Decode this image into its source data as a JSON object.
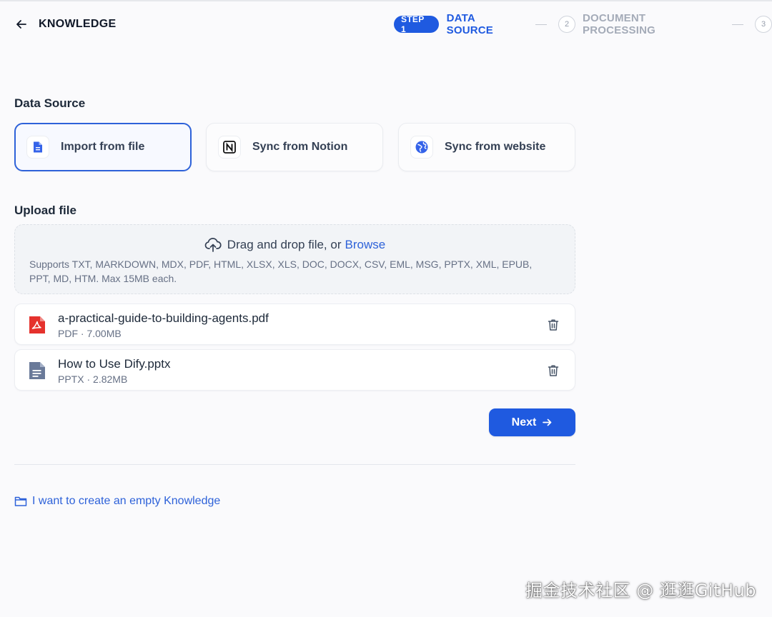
{
  "header": {
    "title": "KNOWLEDGE",
    "back_icon": "arrow-left-icon"
  },
  "steps": {
    "active_badge": "STEP 1",
    "active_label": "DATA SOURCE",
    "step2_number": "2",
    "step2_label": "DOCUMENT PROCESSING",
    "step3_number": "3"
  },
  "data_source": {
    "title": "Data Source",
    "options": [
      {
        "label": "Import from file",
        "icon": "file-icon",
        "selected": true
      },
      {
        "label": "Sync from Notion",
        "icon": "notion-icon",
        "selected": false
      },
      {
        "label": "Sync from website",
        "icon": "globe-icon",
        "selected": false
      }
    ]
  },
  "upload": {
    "title": "Upload file",
    "drop_text": "Drag and drop file, or",
    "browse_label": "Browse",
    "supported_text": "Supports TXT, MARKDOWN, MDX, PDF, HTML, XLSX, XLS, DOC, DOCX, CSV, EML, MSG, PPTX, XML, EPUB, PPT, MD, HTM. Max 15MB each."
  },
  "files": [
    {
      "name": "a-practical-guide-to-building-agents.pdf",
      "type": "PDF",
      "size": "7.00MB",
      "icon": "pdf-icon"
    },
    {
      "name": "How to Use Dify.pptx",
      "type": "PPTX",
      "size": "2.82MB",
      "icon": "document-icon"
    }
  ],
  "meta_separator": "·",
  "next_button": {
    "label": "Next"
  },
  "empty_knowledge_link": "I want to create an empty Knowledge",
  "watermark": "掘金技术社区 @ 逛逛GitHub",
  "colors": {
    "accent": "#1f5ae0",
    "link": "#2e62d9",
    "pdf_red": "#e5322d",
    "doc_slate": "#6a7a99"
  }
}
